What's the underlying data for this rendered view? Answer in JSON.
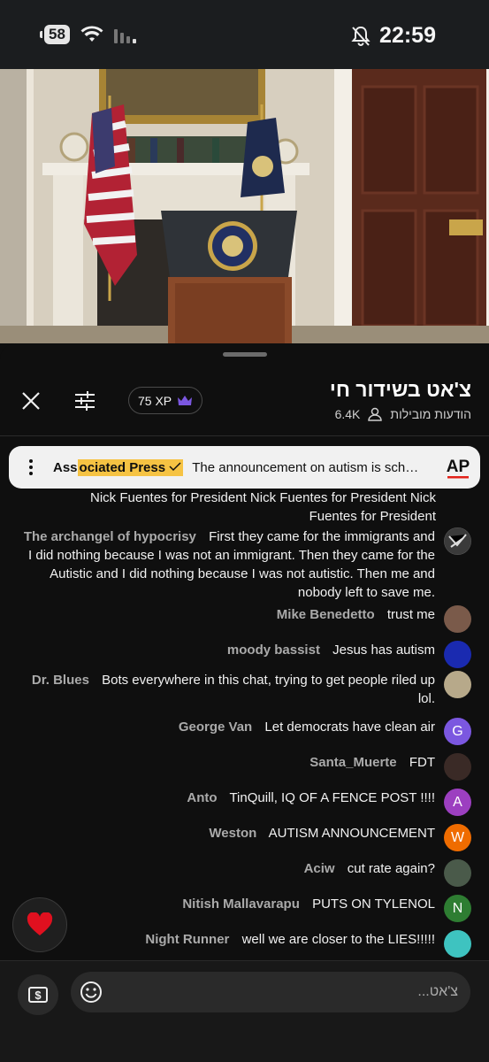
{
  "status_bar": {
    "battery": "58",
    "time": "22:59"
  },
  "chat": {
    "title": "צ'אט בשידור חי",
    "subtitle": "הודעות מובילות",
    "viewers": "6.4K",
    "xp": "75 XP"
  },
  "pinned": {
    "author_hl": "ociated Press",
    "author_plain": "Ass",
    "message": "The announcement on autism is scheduled to begin soon",
    "logo": "AP"
  },
  "messages": [
    {
      "name": "",
      "text": "Nick Fuentes for President Nick Fuentes for President Nick Fuentes for President"
    },
    {
      "name": "The archangel of hypocrisy",
      "text": "First they came for the immigrants and I did nothing because I was not an immigrant. Then they came for the Autistic and I did nothing because I was not autistic. Then me and nobody left to save me."
    },
    {
      "name": "Mike Benedetto",
      "text": "trust me"
    },
    {
      "name": "moody bassist",
      "text": "Jesus has autism"
    },
    {
      "name": "Dr. Blues",
      "text": "Bots everywhere in this chat, trying to get people riled up lol."
    },
    {
      "name": "George Van",
      "text": "Let democrats have clean air",
      "initial": "G"
    },
    {
      "name": "Santa_Muerte",
      "text": "FDT"
    },
    {
      "name": "Anto",
      "text": "TinQuill, IQ OF A FENCE POST !!!!",
      "initial": "A"
    },
    {
      "name": "Weston",
      "text": "AUTISM ANNOUNCEMENT",
      "initial": "W"
    },
    {
      "name": "Aciw",
      "text": "cut rate again?"
    },
    {
      "name": "Nitish Mallavarapu",
      "text": "PUTS ON TYLENOL",
      "initial": "N"
    },
    {
      "name": "Night Runner",
      "text": "well we are closer to the LIES!!!!!"
    }
  ],
  "input": {
    "placeholder": "צ'אט..."
  },
  "colors": {
    "accent_purple": "#7b57e0",
    "pinned_highlight": "#f6c343",
    "avatar_green": "#2e7d32",
    "avatar_orange": "#ef6c00"
  }
}
